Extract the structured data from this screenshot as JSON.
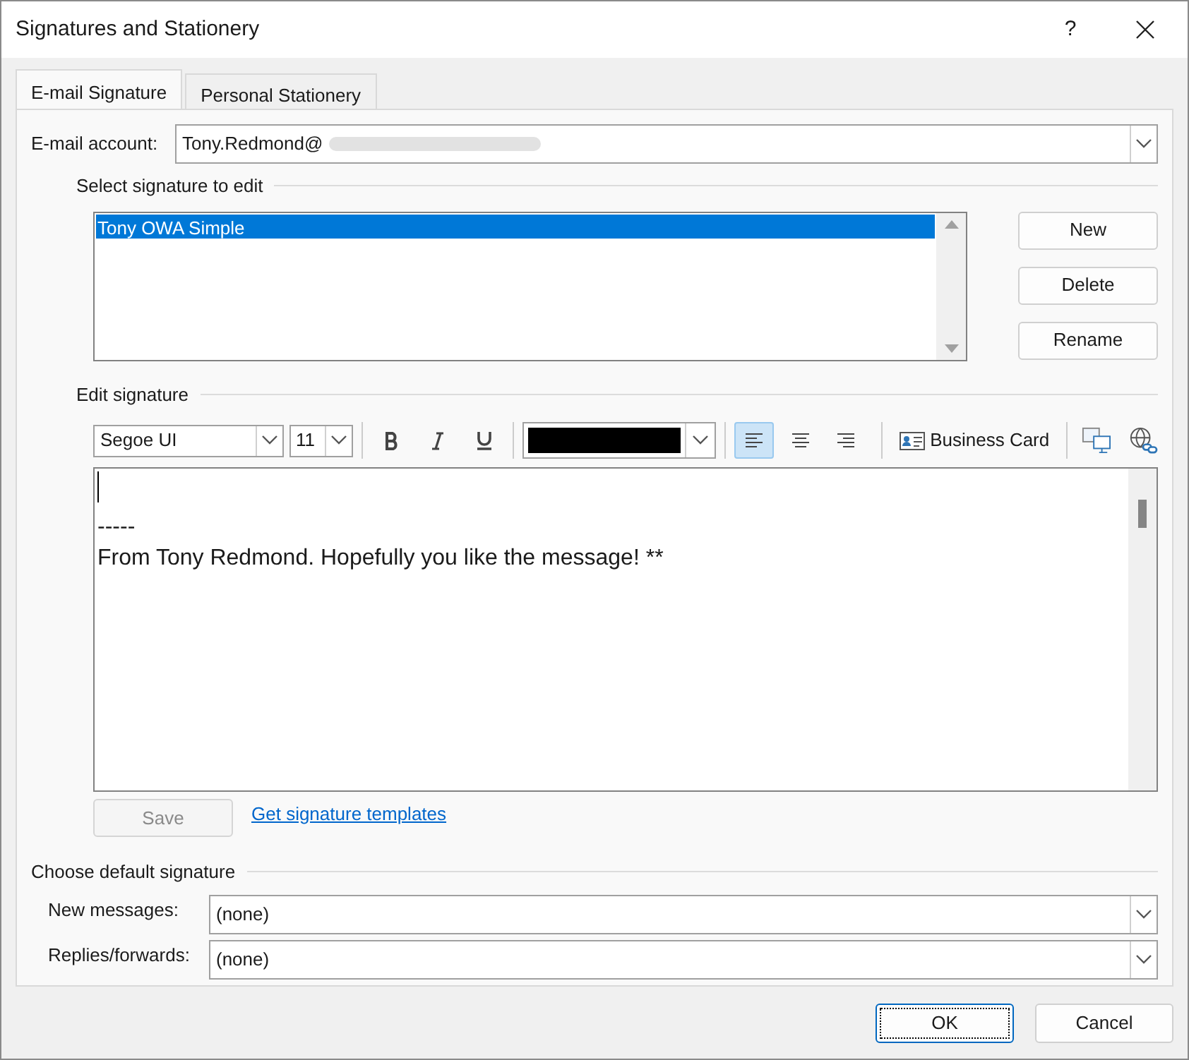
{
  "window": {
    "title": "Signatures and Stationery",
    "help": "?"
  },
  "tabs": [
    {
      "label": "E-mail Signature",
      "selected": true
    },
    {
      "label": "Personal Stationery",
      "selected": false
    }
  ],
  "account": {
    "label": "E-mail account:",
    "value": "Tony.Redmond@"
  },
  "select_section": {
    "title": "Select signature to edit",
    "items": [
      {
        "label": "Tony OWA Simple",
        "selected": true
      }
    ],
    "buttons": [
      {
        "label": "New"
      },
      {
        "label": "Delete"
      },
      {
        "label": "Rename"
      }
    ]
  },
  "edit_section": {
    "title": "Edit signature",
    "font": "Segoe UI",
    "size": "11",
    "bold": false,
    "italic": false,
    "underline": false,
    "color": "#000000",
    "align": [
      {
        "kind": "left",
        "selected": true
      },
      {
        "kind": "center",
        "selected": false
      },
      {
        "kind": "right",
        "selected": false
      }
    ],
    "business_card": "Business Card",
    "lines": [
      "-----",
      "From Tony Redmond. Hopefully you like the message! **"
    ]
  },
  "save": {
    "label": "Save",
    "disabled": true
  },
  "templates_link": "Get signature templates",
  "defaults": {
    "title": "Choose default signature",
    "fields": [
      {
        "label": "New messages:",
        "value": "(none)"
      },
      {
        "label": "Replies/forwards:",
        "value": "(none)"
      }
    ]
  },
  "footer": [
    {
      "label": "OK",
      "default": true
    },
    {
      "label": "Cancel",
      "default": false
    }
  ]
}
